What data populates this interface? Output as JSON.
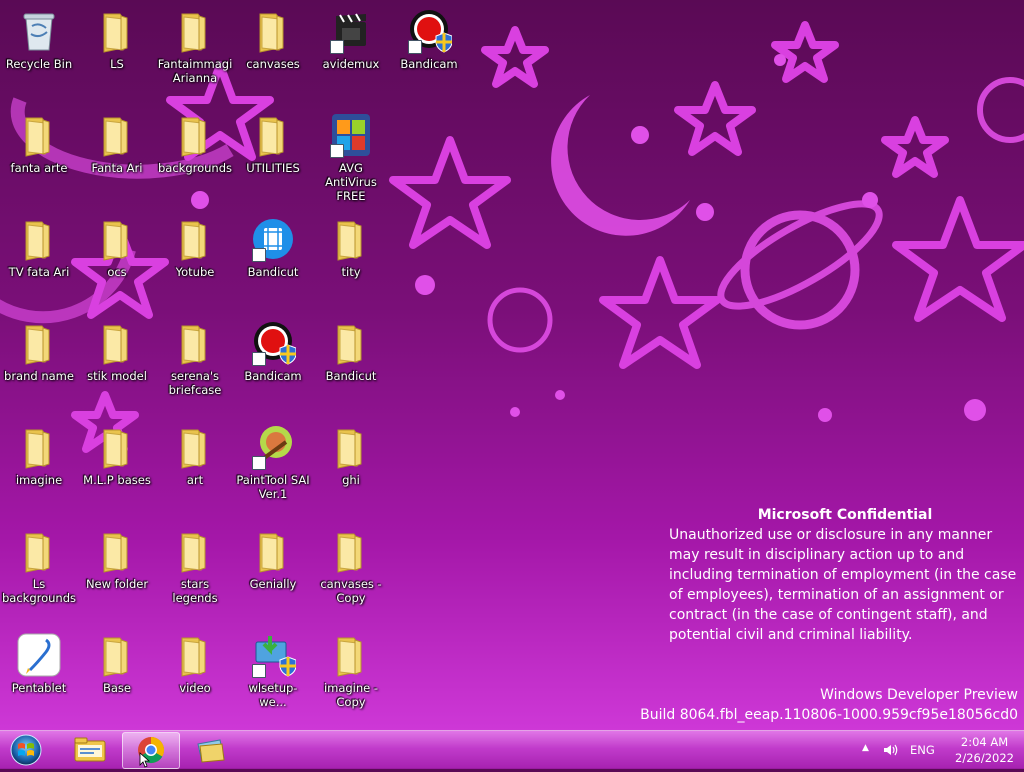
{
  "desktop": {
    "icons": [
      {
        "label": "Recycle Bin",
        "type": "recycle"
      },
      {
        "label": "LS",
        "type": "folder"
      },
      {
        "label": "Fantaimmagi Arianna",
        "type": "folder"
      },
      {
        "label": "canvases",
        "type": "folder"
      },
      {
        "label": "avidemux",
        "type": "app-avidemux"
      },
      {
        "label": "Bandicam",
        "type": "app-bandicam"
      },
      {
        "label": "fanta arte",
        "type": "folder"
      },
      {
        "label": "Fanta Ari",
        "type": "folder"
      },
      {
        "label": "backgrounds",
        "type": "folder"
      },
      {
        "label": "UTILITIES",
        "type": "folder"
      },
      {
        "label": "AVG AntiVirus FREE",
        "type": "app-avg"
      },
      {
        "label": "TV fata Ari",
        "type": "folder"
      },
      {
        "label": "ocs",
        "type": "folder"
      },
      {
        "label": "Yotube",
        "type": "folder"
      },
      {
        "label": "Bandicut",
        "type": "app-bandicut"
      },
      {
        "label": "tity",
        "type": "folder"
      },
      {
        "label": "brand name",
        "type": "folder"
      },
      {
        "label": "stik model",
        "type": "folder"
      },
      {
        "label": "serena's briefcase",
        "type": "folder"
      },
      {
        "label": "Bandicam",
        "type": "app-bandicam"
      },
      {
        "label": "Bandicut",
        "type": "folder"
      },
      {
        "label": "imagine",
        "type": "folder"
      },
      {
        "label": "M.L.P bases",
        "type": "folder"
      },
      {
        "label": "art",
        "type": "folder"
      },
      {
        "label": "PaintTool SAI Ver.1",
        "type": "app-sai"
      },
      {
        "label": "ghi",
        "type": "folder"
      },
      {
        "label": "Ls backgrounds",
        "type": "folder"
      },
      {
        "label": "New folder",
        "type": "folder"
      },
      {
        "label": "stars legends",
        "type": "folder"
      },
      {
        "label": "Genially",
        "type": "folder"
      },
      {
        "label": "canvases - Copy",
        "type": "folder"
      },
      {
        "label": "Pentablet",
        "type": "app-pentablet"
      },
      {
        "label": "Base",
        "type": "folder"
      },
      {
        "label": "video",
        "type": "folder"
      },
      {
        "label": "wlsetup-we...",
        "type": "app-wlsetup"
      },
      {
        "label": "imagine - Copy",
        "type": "folder"
      }
    ]
  },
  "watermark": {
    "title": "Microsoft Confidential",
    "body": "Unauthorized use or disclosure in any manner may result in disciplinary action up to and including termination of employment (in the case of employees), termination of an assignment or contract (in the case of contingent staff), and potential civil and criminal liability."
  },
  "build": {
    "line1": "Windows Developer Preview",
    "line2": "Build 8064.fbl_eeap.110806-1000.959cf95e18056cd0"
  },
  "taskbar": {
    "language": "ENG",
    "time": "2:04 AM",
    "date": "2/26/2022"
  }
}
